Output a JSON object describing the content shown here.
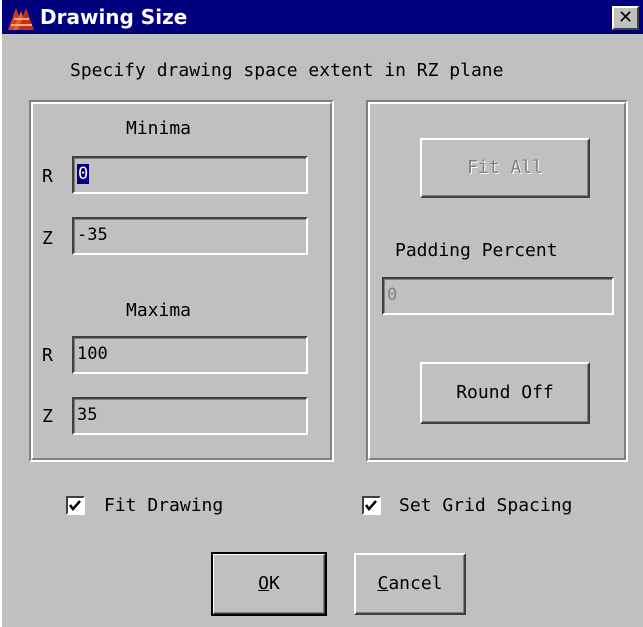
{
  "window": {
    "title": "Drawing Size",
    "close_label": "✕",
    "instruction": "Specify drawing space extent in RZ plane"
  },
  "minima": {
    "heading": "Minima",
    "r_label": "R",
    "r_value": "0",
    "z_label": "Z",
    "z_value": "-35"
  },
  "maxima": {
    "heading": "Maxima",
    "r_label": "R",
    "r_value": "100",
    "z_label": "Z",
    "z_value": "35"
  },
  "right_panel": {
    "fit_all_label": "Fit All",
    "padding_label": "Padding Percent",
    "padding_value": "0",
    "round_off_label": "Round Off"
  },
  "options": {
    "fit_drawing_label": "Fit Drawing",
    "fit_drawing_checked": true,
    "grid_spacing_label": "Set Grid Spacing",
    "grid_spacing_checked": true
  },
  "buttons": {
    "ok_mnemonic": "O",
    "ok_rest": "K",
    "cancel_mnemonic": "C",
    "cancel_rest": "ancel"
  },
  "colors": {
    "titlebar": "#00007f",
    "face": "#c0c0c0",
    "selection": "#00007f"
  },
  "icons": {
    "app": "triangle-logo-icon",
    "close": "close-icon",
    "check": "checkmark-icon"
  }
}
